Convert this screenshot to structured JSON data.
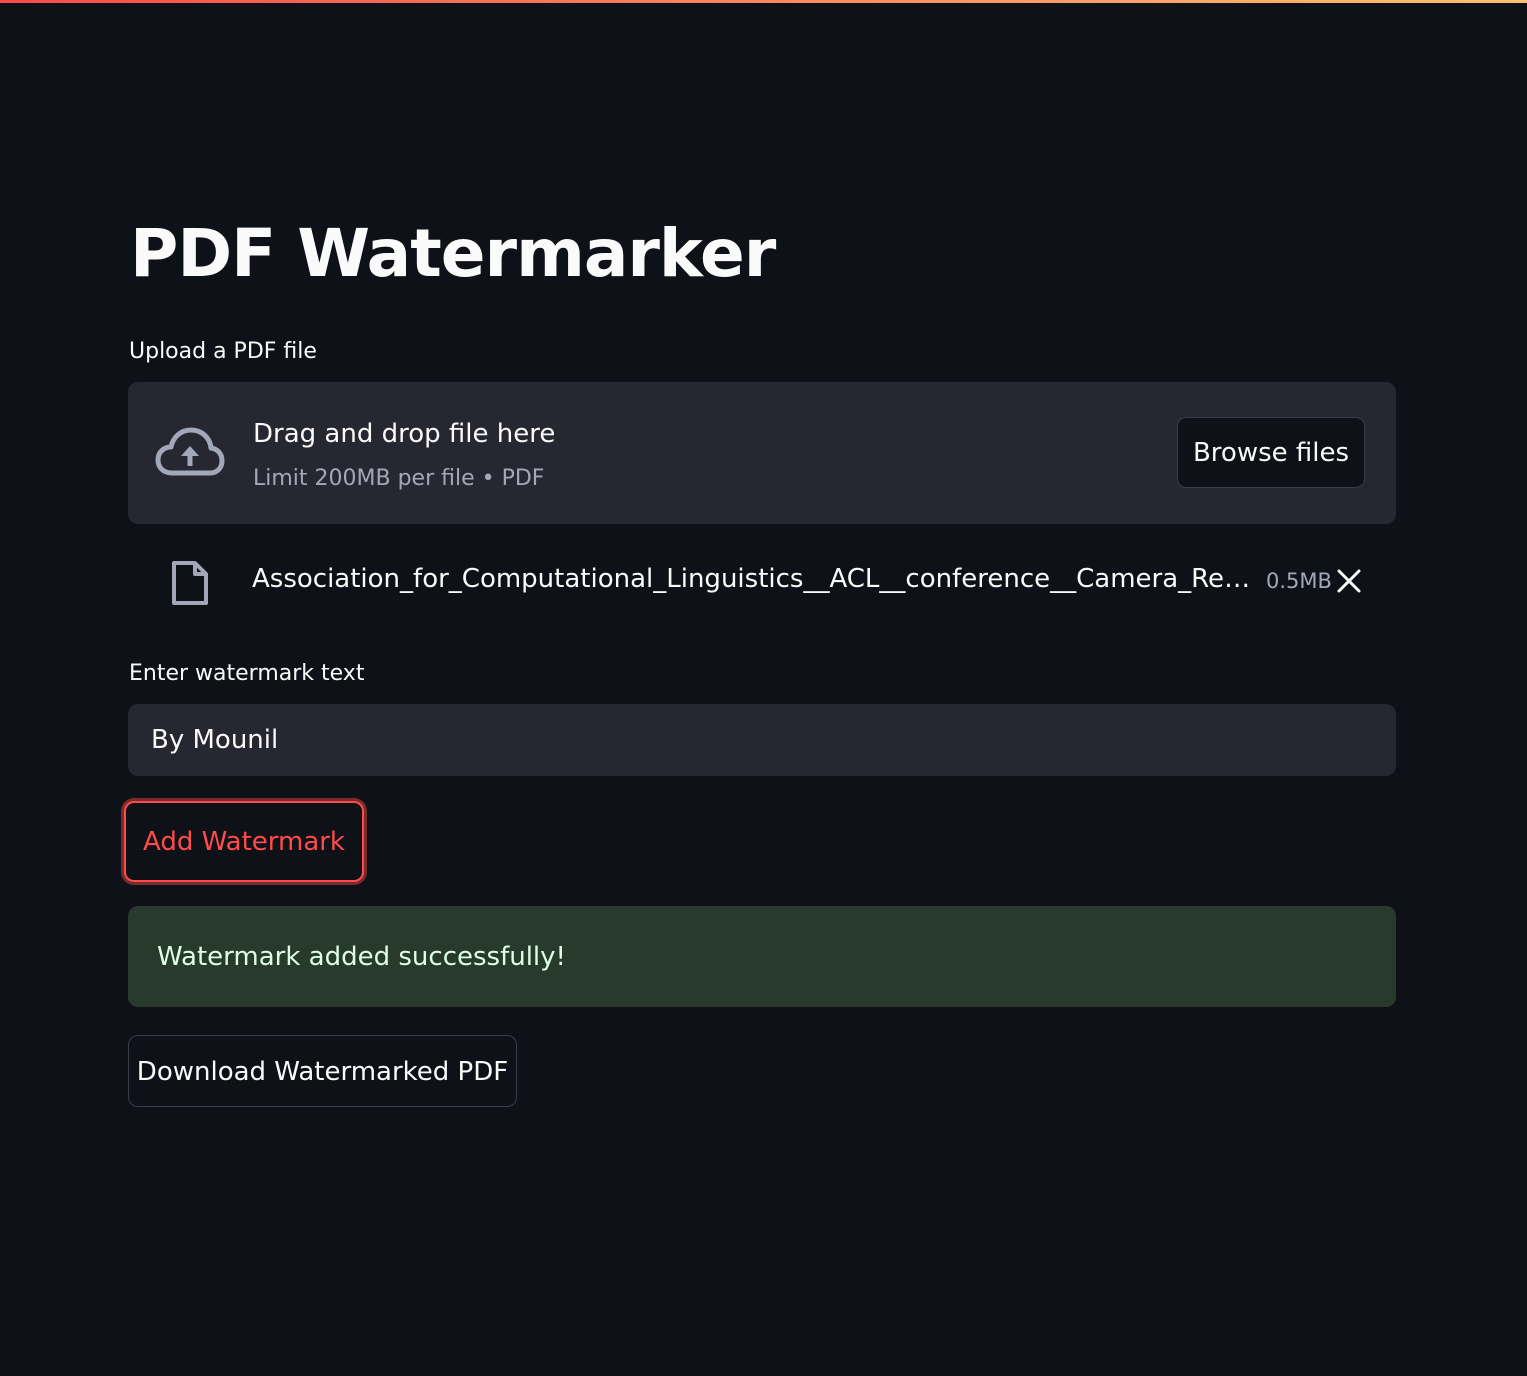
{
  "app": {
    "title": "PDF Watermarker",
    "accent_color": "#ff4b4b",
    "background_color": "#0e1117"
  },
  "uploader": {
    "label": "Upload a PDF file",
    "dropzone_title": "Drag and drop file here",
    "dropzone_limit": "Limit 200MB per file • PDF",
    "browse_label": "Browse files",
    "icon": "cloud-upload-icon"
  },
  "uploaded_file": {
    "name": "Association_for_Computational_Linguistics__ACL__conference__Camera_Ready…",
    "size": "0.5MB",
    "icon": "file-icon",
    "remove_icon": "close-icon"
  },
  "watermark": {
    "label": "Enter watermark text",
    "value": "By Mounil"
  },
  "actions": {
    "add_watermark_label": "Add Watermark",
    "download_label": "Download Watermarked PDF"
  },
  "status": {
    "message": "Watermark added successfully!",
    "color": "#273a2b"
  }
}
